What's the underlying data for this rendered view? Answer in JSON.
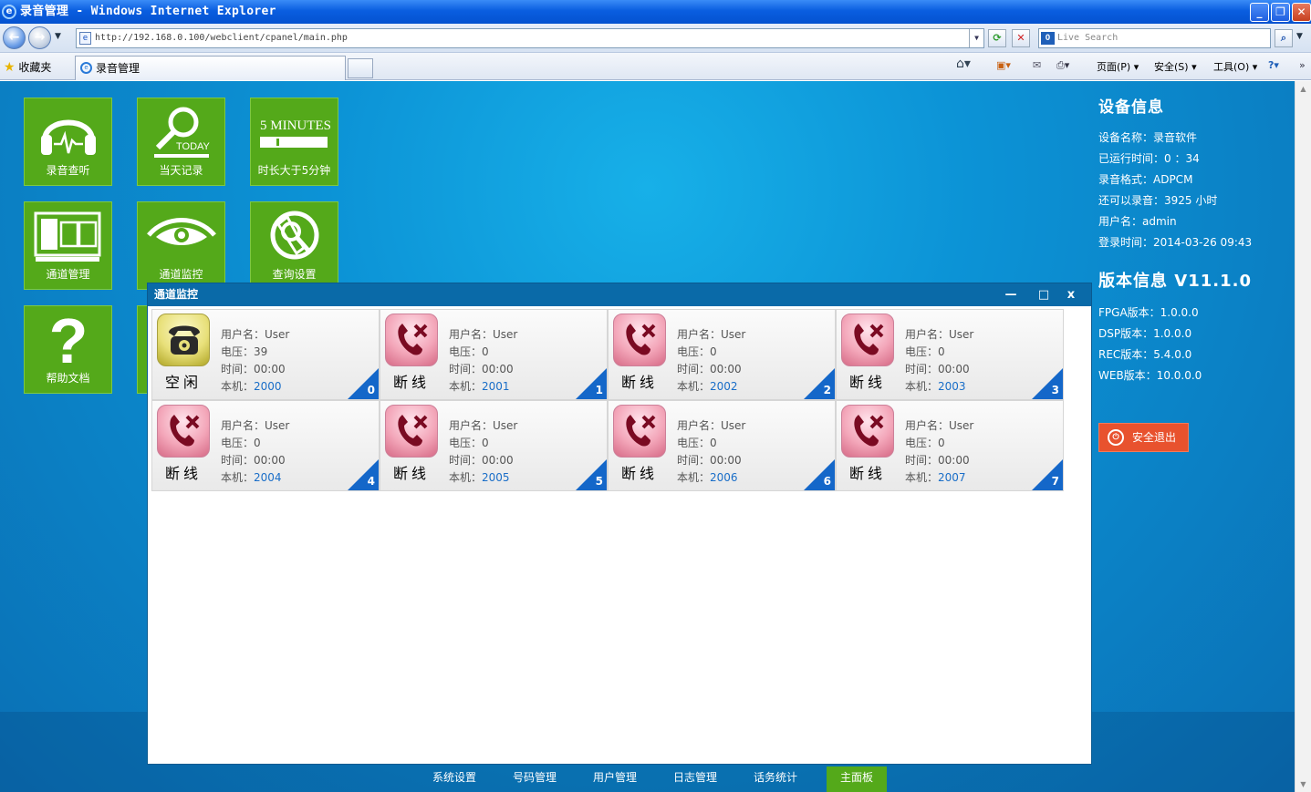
{
  "window": {
    "title": "录音管理 - Windows Internet Explorer",
    "address": "http://192.168.0.100/webclient/cpanel/main.php",
    "search_placeholder": "Live Search",
    "favorites_label": "收藏夹",
    "tab_title": "录音管理",
    "cmd": {
      "page": "页面(P)",
      "safety": "安全(S)",
      "tools": "工具(O)"
    }
  },
  "tiles": [
    {
      "label": "录音查听",
      "icon": "headphones-icon"
    },
    {
      "label": "当天记录",
      "icon": "magnifier-today-icon",
      "icon_text": "TODAY"
    },
    {
      "label": "时长大于5分钟",
      "icon": "five-minutes-icon",
      "icon_text": "5 MINUTES"
    },
    {
      "label": "通道管理",
      "icon": "channel-panel-icon"
    },
    {
      "label": "通道监控",
      "icon": "eye-icon"
    },
    {
      "label": "查询设置",
      "icon": "search-settings-icon"
    },
    {
      "label": "帮助文档",
      "icon": "question-mark-icon"
    }
  ],
  "device_info": {
    "heading": "设备信息",
    "rows": [
      "设备名称：录音软件",
      "已运行时间：0 ：34",
      "录音格式：ADPCM",
      "还可以录音：3925 小时",
      "用户名：admin",
      "登录时间：2014-03-26 09:43"
    ]
  },
  "version_info": {
    "heading": "版本信息 V11.1.0",
    "rows": [
      "FPGA版本：1.0.0.0",
      "DSP版本：1.0.0.0",
      "REC版本：5.4.0.0",
      "WEB版本：10.0.0.0"
    ]
  },
  "logout_label": "安全退出",
  "monitor": {
    "title": "通道监控",
    "labels": {
      "user": "用户名：",
      "voltage": "电压：",
      "time": "时间：",
      "ext": "本机："
    },
    "channels": [
      {
        "status": "空闲",
        "state": "idle",
        "user": "User",
        "voltage": "39",
        "time": "00:00",
        "ext": "2000",
        "num": "0"
      },
      {
        "status": "断线",
        "state": "off",
        "user": "User",
        "voltage": "0",
        "time": "00:00",
        "ext": "2001",
        "num": "1"
      },
      {
        "status": "断线",
        "state": "off",
        "user": "User",
        "voltage": "0",
        "time": "00:00",
        "ext": "2002",
        "num": "2"
      },
      {
        "status": "断线",
        "state": "off",
        "user": "User",
        "voltage": "0",
        "time": "00:00",
        "ext": "2003",
        "num": "3"
      },
      {
        "status": "断线",
        "state": "off",
        "user": "User",
        "voltage": "0",
        "time": "00:00",
        "ext": "2004",
        "num": "4"
      },
      {
        "status": "断线",
        "state": "off",
        "user": "User",
        "voltage": "0",
        "time": "00:00",
        "ext": "2005",
        "num": "5"
      },
      {
        "status": "断线",
        "state": "off",
        "user": "User",
        "voltage": "0",
        "time": "00:00",
        "ext": "2006",
        "num": "6"
      },
      {
        "status": "断线",
        "state": "off",
        "user": "User",
        "voltage": "0",
        "time": "00:00",
        "ext": "2007",
        "num": "7"
      }
    ]
  },
  "bottom_nav": [
    {
      "label": "系统设置",
      "active": false
    },
    {
      "label": "号码管理",
      "active": false
    },
    {
      "label": "用户管理",
      "active": false
    },
    {
      "label": "日志管理",
      "active": false
    },
    {
      "label": "话务统计",
      "active": false
    },
    {
      "label": "主面板",
      "active": true
    }
  ]
}
